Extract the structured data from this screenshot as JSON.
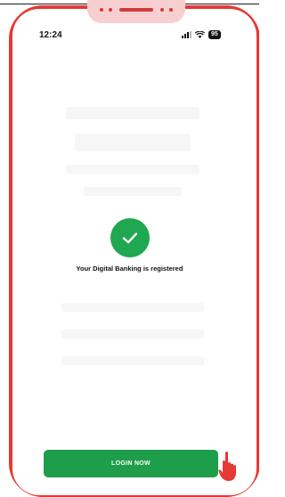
{
  "status_bar": {
    "time": "12:24",
    "battery": "95",
    "icons": [
      "signal-icon",
      "wifi-icon",
      "battery-icon"
    ]
  },
  "success": {
    "icon": "check-icon",
    "message": "Your Digital Banking is registered",
    "color": "#1fa84f"
  },
  "actions": {
    "login_label": "LOGIN NOW",
    "login_color": "#1e9e4a"
  },
  "frame": {
    "border_color": "#e53935",
    "pointer_icon": "hand-pointer-icon"
  }
}
